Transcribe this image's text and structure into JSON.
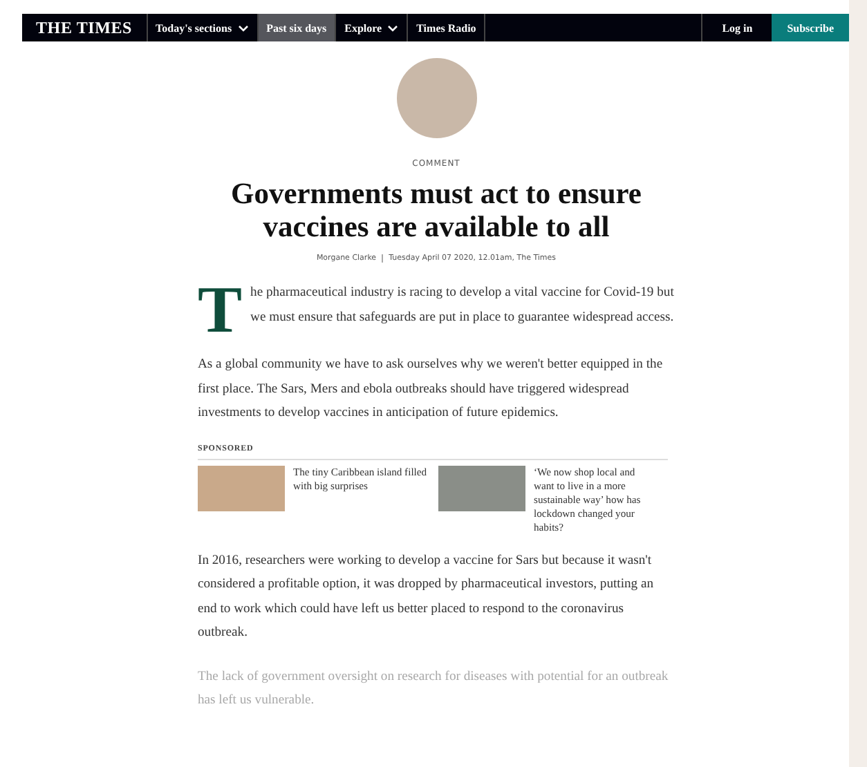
{
  "nav": {
    "logo": "THE TIMES",
    "items": [
      {
        "label": "Today's sections",
        "selected": false,
        "dropdown": true
      },
      {
        "label": "Past six days",
        "selected": true,
        "dropdown": false
      },
      {
        "label": "Explore",
        "selected": false,
        "dropdown": true
      },
      {
        "label": "Times Radio",
        "selected": false,
        "dropdown": false
      }
    ],
    "login": "Log in",
    "subscribe": "Subscribe"
  },
  "article": {
    "section": "COMMENT",
    "headline": "Governments must act to ensure vaccines are available to all",
    "author": "Morgane Clarke",
    "dateline": "Tuesday April 07 2020, 12.01am, The Times",
    "paragraphs": [
      {
        "text": "The pharmaceutical industry is racing to develop a vital vaccine for Covid-19 but we must ensure that safeguards are put in place to guarantee widespread access.",
        "kind": "dropcap",
        "faded": false
      },
      {
        "text": "As a global community we have to ask ourselves why we weren't better equipped in the first place. The Sars, Mers and ebola outbreaks should have triggered widespread investments to develop vaccines in anticipation of future epidemics.",
        "kind": "body",
        "faded": false
      },
      {
        "kind": "sponsored",
        "label": "SPONSORED",
        "items": [
          {
            "title": "The tiny Caribbean island filled with big surprises"
          },
          {
            "title": "‘We now shop local and want to live in a more sustainable way’ how has lockdown changed your habits?"
          }
        ]
      },
      {
        "text": "In 2016, researchers were working to develop a vaccine for Sars but because it wasn't considered a profitable option, it was dropped by pharmaceutical investors, putting an end to work which could have left us better placed to respond to the coronavirus outbreak.",
        "kind": "body",
        "faded": false
      },
      {
        "text": "The lack of government oversight on research for diseases with potential for an outbreak has left us vulnerable.",
        "kind": "body",
        "faded": true
      }
    ]
  }
}
